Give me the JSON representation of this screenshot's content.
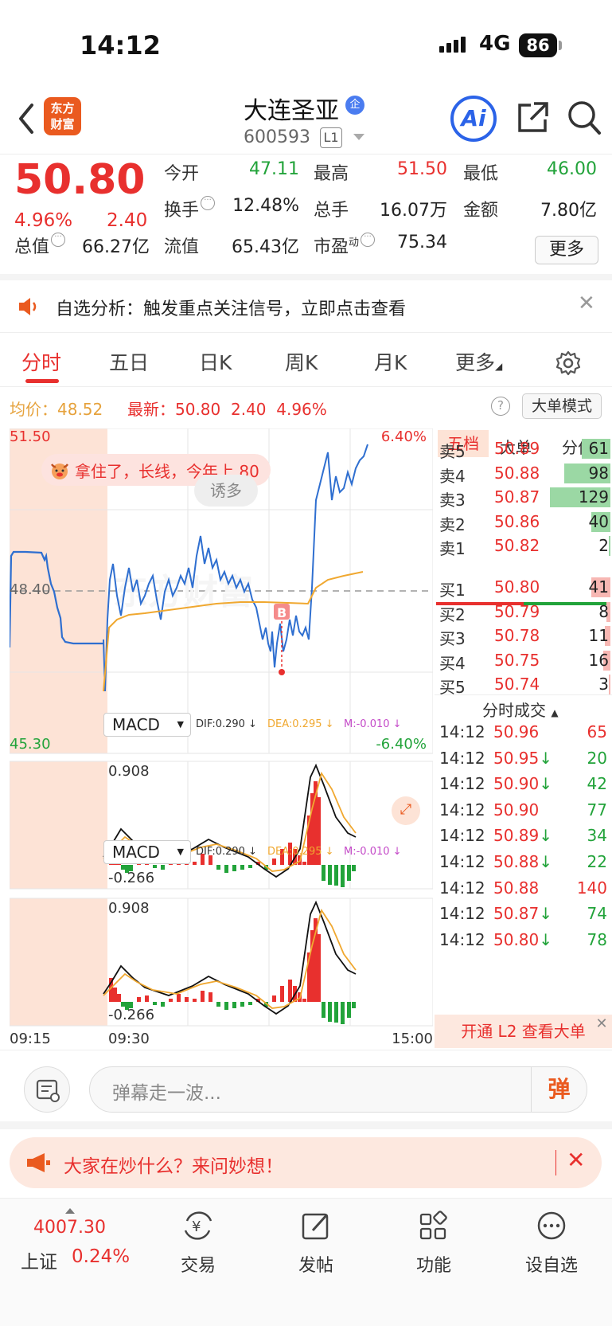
{
  "status": {
    "time": "14:12",
    "network": "4G",
    "battery": "86"
  },
  "header": {
    "stock_name": "大连圣亚",
    "enterprise_badge": "企",
    "code": "600593",
    "level": "L1",
    "logo_line1": "东方",
    "logo_line2": "财富",
    "ai_label": "Ai"
  },
  "quote": {
    "price": "50.80",
    "change_pct": "4.96%",
    "change": "2.40",
    "open_label": "今开",
    "open": "47.11",
    "high_label": "最高",
    "high": "51.50",
    "low_label": "最低",
    "low": "46.00",
    "turnover_label": "换手",
    "turnover": "12.48%",
    "volume_label": "总手",
    "volume": "16.07万",
    "amount_label": "金额",
    "amount": "7.80亿",
    "mcap_label": "总值",
    "mcap": "66.27亿",
    "float_label": "流值",
    "float_cap": "65.43亿",
    "pe_label": "市盈",
    "pe_sup": "动",
    "pe": "75.34",
    "more_label": "更多"
  },
  "notice": {
    "text": "自选分析：触发重点关注信号，立即点击查看"
  },
  "tabs": [
    "分时",
    "五日",
    "日K",
    "周K",
    "月K",
    "更多"
  ],
  "infobar": {
    "avg_label": "均价：",
    "avg": "48.52",
    "latest_label": "最新：",
    "latest": "50.80",
    "latest_chg": "2.40",
    "latest_pct": "4.96%",
    "help": "?",
    "mode": "大单模式"
  },
  "chart_labels": {
    "y_top": "51.50",
    "y_mid": "48.40",
    "y_bot": "45.30",
    "pct_top": "6.40%",
    "pct_bot": "-6.40%",
    "bubble": "拿住了，长线，今年上 80",
    "tag": "诱多",
    "b_marker": "B",
    "watermark": "东方财富"
  },
  "macd": {
    "name": "MACD",
    "dif": "DIF:0.290 ↓",
    "dea": "DEA:0.295 ↓",
    "m": "M:-0.010 ↓",
    "max": "0.908",
    "min": "-0.266"
  },
  "xaxis": {
    "start": "09:15",
    "open": "09:30",
    "end": "15:00"
  },
  "orderbook": {
    "tabs": [
      "五档",
      "大单",
      "分价"
    ],
    "asks": [
      {
        "label": "卖5",
        "price": "50.89",
        "vol": "61",
        "level": 0.47
      },
      {
        "label": "卖4",
        "price": "50.88",
        "vol": "98",
        "level": 0.76
      },
      {
        "label": "卖3",
        "price": "50.87",
        "vol": "129",
        "level": 1.0
      },
      {
        "label": "卖2",
        "price": "50.86",
        "vol": "40",
        "level": 0.31
      },
      {
        "label": "卖1",
        "price": "50.82",
        "vol": "2",
        "level": 0.02
      }
    ],
    "bids": [
      {
        "label": "买1",
        "price": "50.80",
        "vol": "41",
        "level": 0.32
      },
      {
        "label": "买2",
        "price": "50.79",
        "vol": "8",
        "level": 0.06
      },
      {
        "label": "买3",
        "price": "50.78",
        "vol": "11",
        "level": 0.09
      },
      {
        "label": "买4",
        "price": "50.75",
        "vol": "16",
        "level": 0.12
      },
      {
        "label": "买5",
        "price": "50.74",
        "vol": "3",
        "level": 0.02
      }
    ],
    "trades_title": "分时成交",
    "trades": [
      {
        "time": "14:12",
        "price": "50.96",
        "arrow": "",
        "vol": "65",
        "side": "buy"
      },
      {
        "time": "14:12",
        "price": "50.95",
        "arrow": "↓",
        "vol": "20",
        "side": "sell"
      },
      {
        "time": "14:12",
        "price": "50.90",
        "arrow": "↓",
        "vol": "42",
        "side": "sell"
      },
      {
        "time": "14:12",
        "price": "50.90",
        "arrow": "",
        "vol": "77",
        "side": "sell"
      },
      {
        "time": "14:12",
        "price": "50.89",
        "arrow": "↓",
        "vol": "34",
        "side": "sell"
      },
      {
        "time": "14:12",
        "price": "50.88",
        "arrow": "↓",
        "vol": "22",
        "side": "sell"
      },
      {
        "time": "14:12",
        "price": "50.88",
        "arrow": "",
        "vol": "140",
        "side": "buy"
      },
      {
        "time": "14:12",
        "price": "50.87",
        "arrow": "↓",
        "vol": "74",
        "side": "sell"
      },
      {
        "time": "14:12",
        "price": "50.80",
        "arrow": "↓",
        "vol": "78",
        "side": "sell"
      }
    ],
    "l2": "开通 L2 查看大单"
  },
  "danmu": {
    "placeholder": "弹幕走一波...",
    "button": "弹"
  },
  "ad": {
    "text": "大家在炒什么？来问妙想！"
  },
  "nav": {
    "index_value": "4007.30",
    "index_name": "上证",
    "index_pct": "0.24%",
    "items": [
      "交易",
      "发帖",
      "功能",
      "设自选"
    ]
  },
  "colors": {
    "up": "#e8302e",
    "down": "#22a33a",
    "avg": "#f0a830",
    "price_line": "#2f6fd0",
    "accent": "#ea5a1f"
  }
}
